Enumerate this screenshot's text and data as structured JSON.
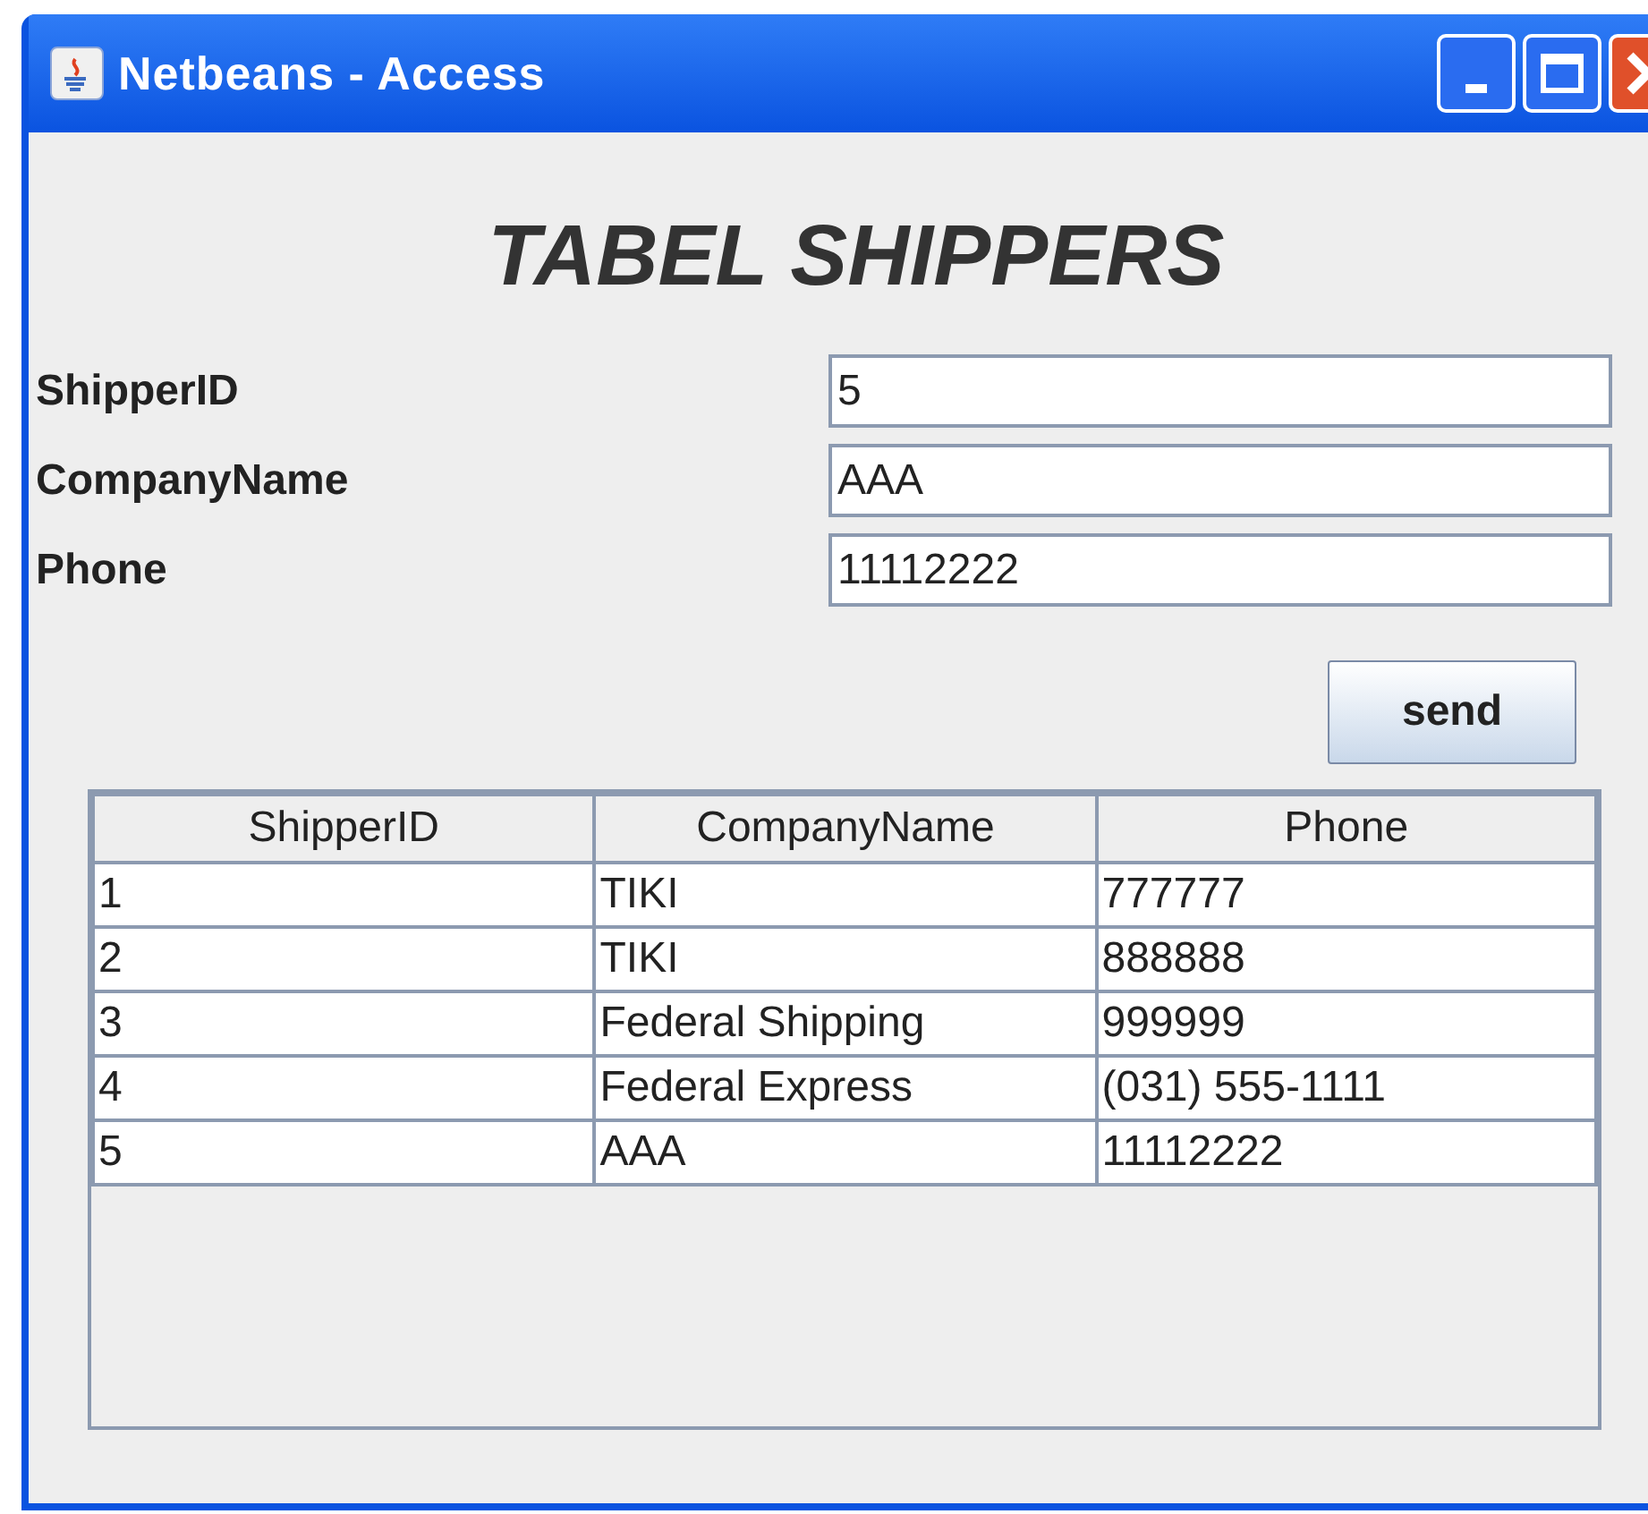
{
  "window": {
    "title": "Netbeans - Access"
  },
  "heading": "TABEL SHIPPERS",
  "fields": [
    {
      "label": "ShipperID",
      "value": "5"
    },
    {
      "label": "CompanyName",
      "value": "AAA"
    },
    {
      "label": "Phone",
      "value": "11112222"
    }
  ],
  "send_button": "send",
  "table": {
    "columns": [
      "ShipperID",
      "CompanyName",
      "Phone"
    ],
    "rows": [
      [
        "1",
        "TIKI",
        "777777"
      ],
      [
        "2",
        "TIKI",
        "888888"
      ],
      [
        "3",
        "Federal Shipping",
        "999999"
      ],
      [
        "4",
        "Federal Express",
        "(031) 555-1111"
      ],
      [
        "5",
        "AAA",
        "11112222"
      ]
    ]
  }
}
